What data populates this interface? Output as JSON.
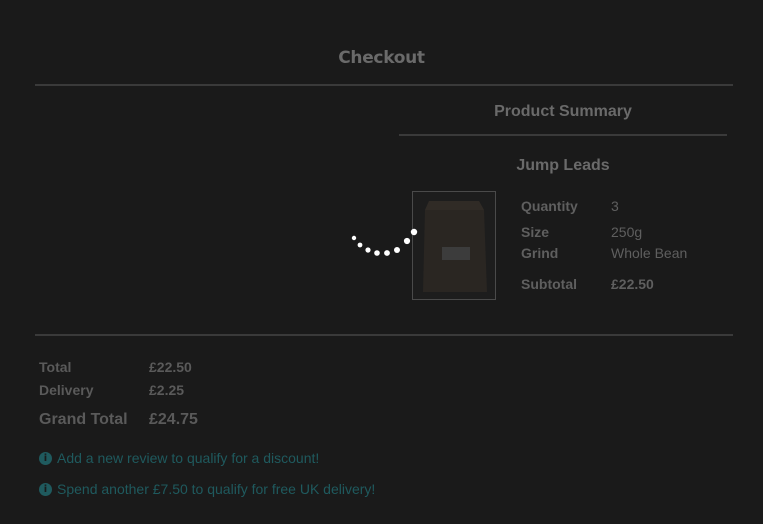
{
  "page": {
    "title": "Checkout"
  },
  "summary": {
    "heading": "Product Summary",
    "product": {
      "name": "Jump Leads",
      "image_label": "product-bag",
      "quantity_label": "Quantity",
      "quantity": "3",
      "size_label": "Size",
      "size": "250g",
      "grind_label": "Grind",
      "grind": "Whole Bean",
      "subtotal_label": "Subtotal",
      "subtotal": "£22.50"
    }
  },
  "totals": {
    "total_label": "Total",
    "total": "£22.50",
    "delivery_label": "Delivery",
    "delivery": "£2.25",
    "grand_label": "Grand Total",
    "grand": "£24.75"
  },
  "notices": [
    {
      "icon": "info-icon",
      "text": "Add a new review to qualify for a discount!"
    },
    {
      "icon": "info-icon",
      "text": "Spend another £7.50 to qualify for free UK delivery!"
    }
  ],
  "overlay": {
    "state": "loading",
    "spinner_icon": "loading-spinner-icon"
  },
  "colors": {
    "overlay": "#1a1a1a",
    "notice": "#1f5a5e",
    "spinner": "#ffffff"
  }
}
